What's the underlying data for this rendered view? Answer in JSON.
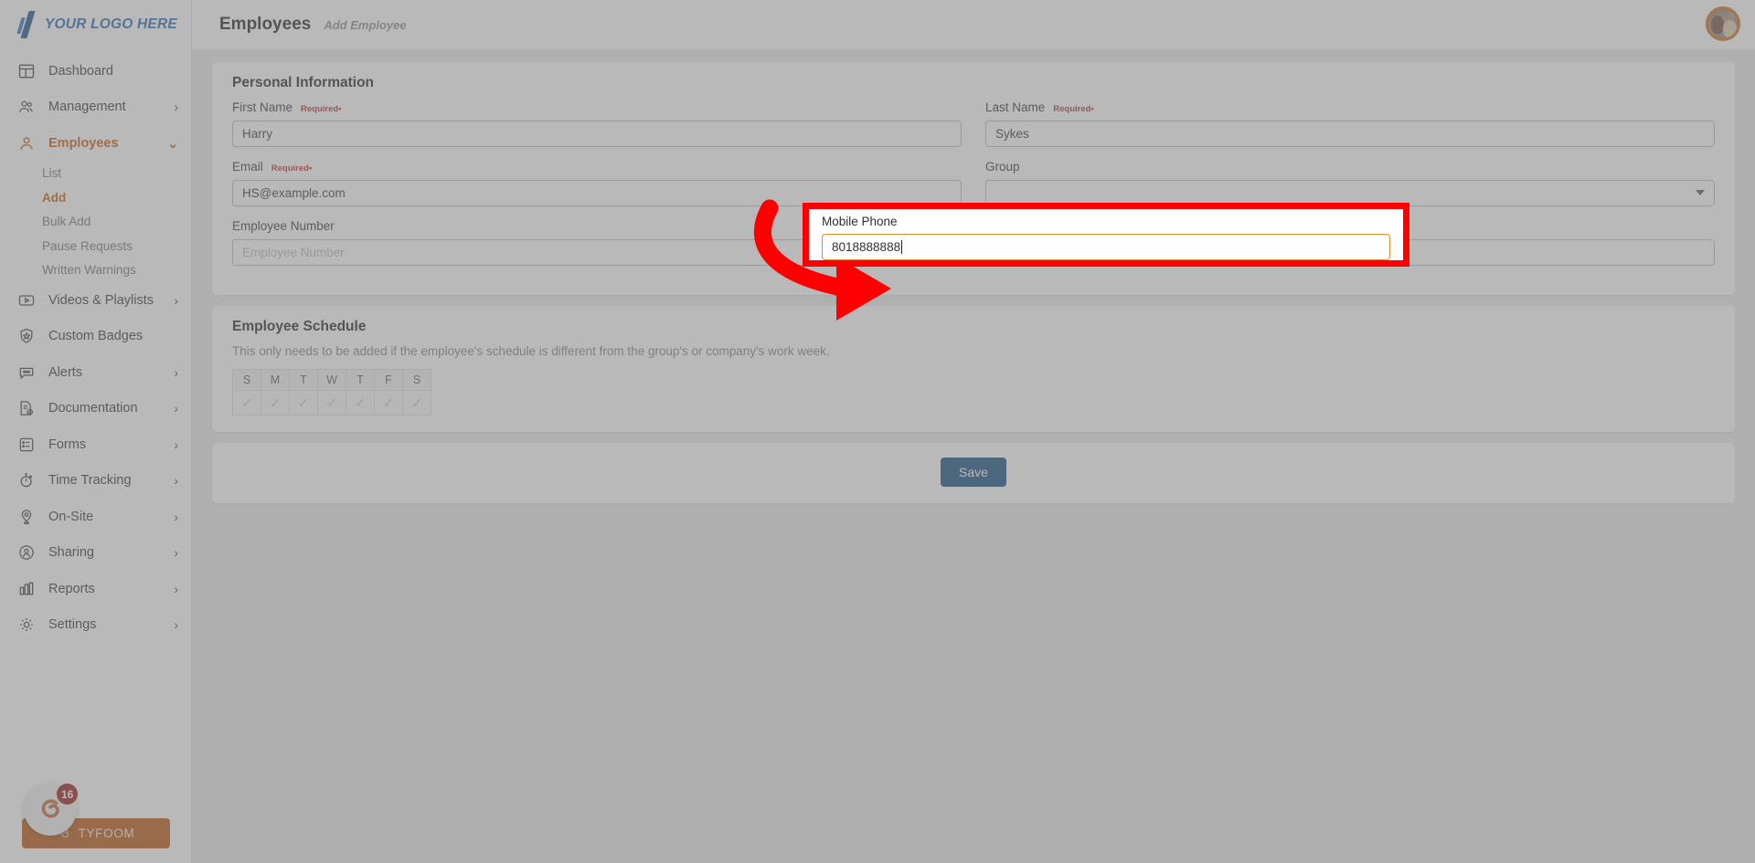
{
  "brand": {
    "logo_text": "YOUR LOGO HERE",
    "logo_color": "#2266aa",
    "accent_color": "#c2590f",
    "highlight_color": "#ff0000",
    "focus_color": "#e08a29"
  },
  "sidebar": {
    "items": [
      {
        "label": "Dashboard",
        "icon": "dashboard-icon",
        "chevron": "",
        "active": false
      },
      {
        "label": "Management",
        "icon": "people-icon",
        "chevron": "›",
        "active": false
      },
      {
        "label": "Employees",
        "icon": "person-icon",
        "chevron": "⌄",
        "active": true
      },
      {
        "label": "Videos & Playlists",
        "icon": "video-play-icon",
        "chevron": "›",
        "active": false
      },
      {
        "label": "Custom Badges",
        "icon": "shield-star-icon",
        "chevron": "",
        "active": false
      },
      {
        "label": "Alerts",
        "icon": "chat-bubble-icon",
        "chevron": "›",
        "active": false
      },
      {
        "label": "Documentation",
        "icon": "document-check-icon",
        "chevron": "›",
        "active": false
      },
      {
        "label": "Forms",
        "icon": "form-list-icon",
        "chevron": "›",
        "active": false
      },
      {
        "label": "Time Tracking",
        "icon": "stopwatch-icon",
        "chevron": "›",
        "active": false
      },
      {
        "label": "On-Site",
        "icon": "map-pin-icon",
        "chevron": "›",
        "active": false
      },
      {
        "label": "Sharing",
        "icon": "share-person-icon",
        "chevron": "›",
        "active": false
      },
      {
        "label": "Reports",
        "icon": "bar-chart-icon",
        "chevron": "›",
        "active": false
      },
      {
        "label": "Settings",
        "icon": "gear-icon",
        "chevron": "›",
        "active": false
      }
    ],
    "employees_submenu": [
      {
        "label": "List",
        "active": false
      },
      {
        "label": "Add",
        "active": true
      },
      {
        "label": "Bulk Add",
        "active": false
      },
      {
        "label": "Pause Requests",
        "active": false
      },
      {
        "label": "Written Warnings",
        "active": false
      }
    ],
    "tyfoom": {
      "label": "TYFOOM",
      "badge_count": "16"
    }
  },
  "header": {
    "title": "Employees",
    "subtitle": "Add Employee"
  },
  "personal_information": {
    "section_title": "Personal Information",
    "required_label": "Required",
    "required_dot": "•",
    "first_name": {
      "label": "First Name",
      "value": "Harry",
      "placeholder": "First Name",
      "required": true
    },
    "last_name": {
      "label": "Last Name",
      "value": "Sykes",
      "placeholder": "Last Name",
      "required": true
    },
    "email": {
      "label": "Email",
      "value": "HS@example.com",
      "placeholder": "Email",
      "required": true
    },
    "group": {
      "label": "Group",
      "value": "",
      "placeholder": "",
      "required": false
    },
    "employee_number": {
      "label": "Employee Number",
      "value": "",
      "placeholder": "Employee Number",
      "required": false
    },
    "mobile_phone": {
      "label": "Mobile Phone",
      "value": "8018888888",
      "placeholder": "Mobile Phone",
      "required": false,
      "focused": true
    }
  },
  "employee_schedule": {
    "section_title": "Employee Schedule",
    "note": "This only needs to be added if the employee's schedule is different from the group's or company's work week.",
    "day_headers": [
      "S",
      "M",
      "T",
      "W",
      "T",
      "F",
      "S"
    ],
    "day_checks": [
      "✓",
      "✓",
      "✓",
      "✓",
      "✓",
      "✓",
      "✓"
    ]
  },
  "footer": {
    "save_label": "Save"
  }
}
